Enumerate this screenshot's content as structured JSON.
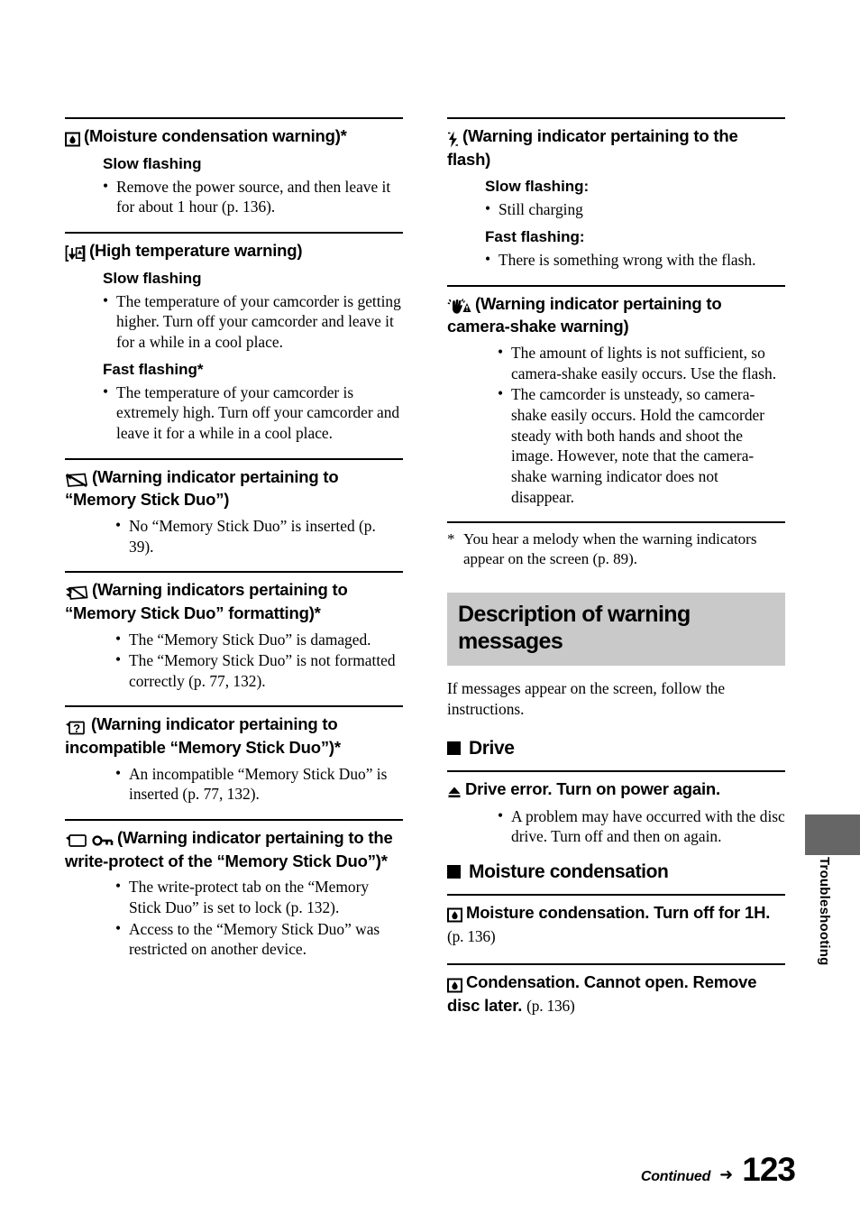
{
  "page": {
    "number": "123",
    "continued_label": "Continued",
    "continued_arrow": "➜",
    "side_tab_label": "Troubleshooting",
    "gray_tab_color": "#666666",
    "banner_color": "#c9c9c9"
  },
  "left_column": {
    "sections": [
      {
        "icon": "moisture-condensation-icon",
        "heading": "(Moisture condensation warning)*",
        "subsections": [
          {
            "label": "Slow flashing",
            "bullets": [
              "Remove the power source, and then leave it for about 1 hour (p. 136)."
            ]
          }
        ]
      },
      {
        "icon": "high-temperature-icon",
        "heading": "(High temperature warning)",
        "subsections": [
          {
            "label": "Slow flashing",
            "bullets": [
              "The temperature of your camcorder is getting higher. Turn off your camcorder and leave it for a while in a cool place."
            ]
          },
          {
            "label": "Fast flashing*",
            "bullets": [
              "The temperature of your camcorder is extremely high. Turn off your camcorder and leave it for a while in a cool place."
            ]
          }
        ]
      },
      {
        "icon": "memory-stick-no-media-icon",
        "heading": "(Warning indicator pertaining to “Memory Stick Duo”)",
        "bullets": [
          "No “Memory Stick Duo” is inserted (p. 39)."
        ]
      },
      {
        "icon": "memory-stick-format-icon",
        "heading": "(Warning indicators pertaining to “Memory Stick Duo” formatting)*",
        "bullets": [
          "The “Memory Stick Duo” is damaged.",
          "The “Memory Stick Duo” is not formatted correctly (p. 77, 132)."
        ]
      },
      {
        "icon": "memory-stick-incompatible-icon",
        "heading": "(Warning indicator pertaining to incompatible “Memory Stick Duo”)*",
        "bullets": [
          "An incompatible “Memory Stick Duo” is inserted (p. 77, 132)."
        ]
      },
      {
        "icon": "memory-stick-write-protect-icon",
        "heading": "(Warning indicator pertaining to the write-protect of the “Memory Stick Duo”)*",
        "bullets": [
          "The write-protect tab on the “Memory Stick Duo” is set to lock (p. 132).",
          "Access to the “Memory Stick Duo” was restricted on another device."
        ]
      }
    ]
  },
  "right_column": {
    "sections": [
      {
        "icon": "flash-icon",
        "heading": "(Warning indicator pertaining to the flash)",
        "subsections": [
          {
            "label": "Slow flashing:",
            "bullets": [
              "Still charging"
            ]
          },
          {
            "label": "Fast flashing:",
            "bullets": [
              "There is something wrong with the flash."
            ]
          }
        ]
      },
      {
        "icon": "camera-shake-icon",
        "heading": "(Warning indicator pertaining to camera-shake warning)",
        "bullets": [
          "The amount of lights is not sufficient, so camera-shake easily occurs. Use the flash.",
          "The camcorder is unsteady, so camera-shake easily occurs. Hold the camcorder steady with both hands and shoot the image. However, note that the camera-shake warning indicator does not disappear."
        ]
      }
    ],
    "footnote": {
      "marker": "*",
      "text": "You hear a melody when the warning indicators appear on the screen (p. 89)."
    },
    "banner_title": "Description of warning messages",
    "intro": "If messages appear on the screen, follow the instructions.",
    "categories": [
      {
        "title": "Drive",
        "messages": [
          {
            "icon": "eject-icon",
            "text": "Drive error. Turn on power again.",
            "page_ref": "",
            "bullets": [
              "A problem may have occurred with the disc drive. Turn off and then on again."
            ]
          }
        ]
      },
      {
        "title": "Moisture condensation",
        "messages": [
          {
            "icon": "moisture-condensation-icon",
            "text": "Moisture condensation. Turn off for 1H.",
            "page_ref": "(p. 136)",
            "bullets": []
          },
          {
            "icon": "moisture-condensation-icon",
            "text": "Condensation. Cannot open. Remove disc later.",
            "page_ref": "(p. 136)",
            "bullets": []
          }
        ]
      }
    ]
  }
}
